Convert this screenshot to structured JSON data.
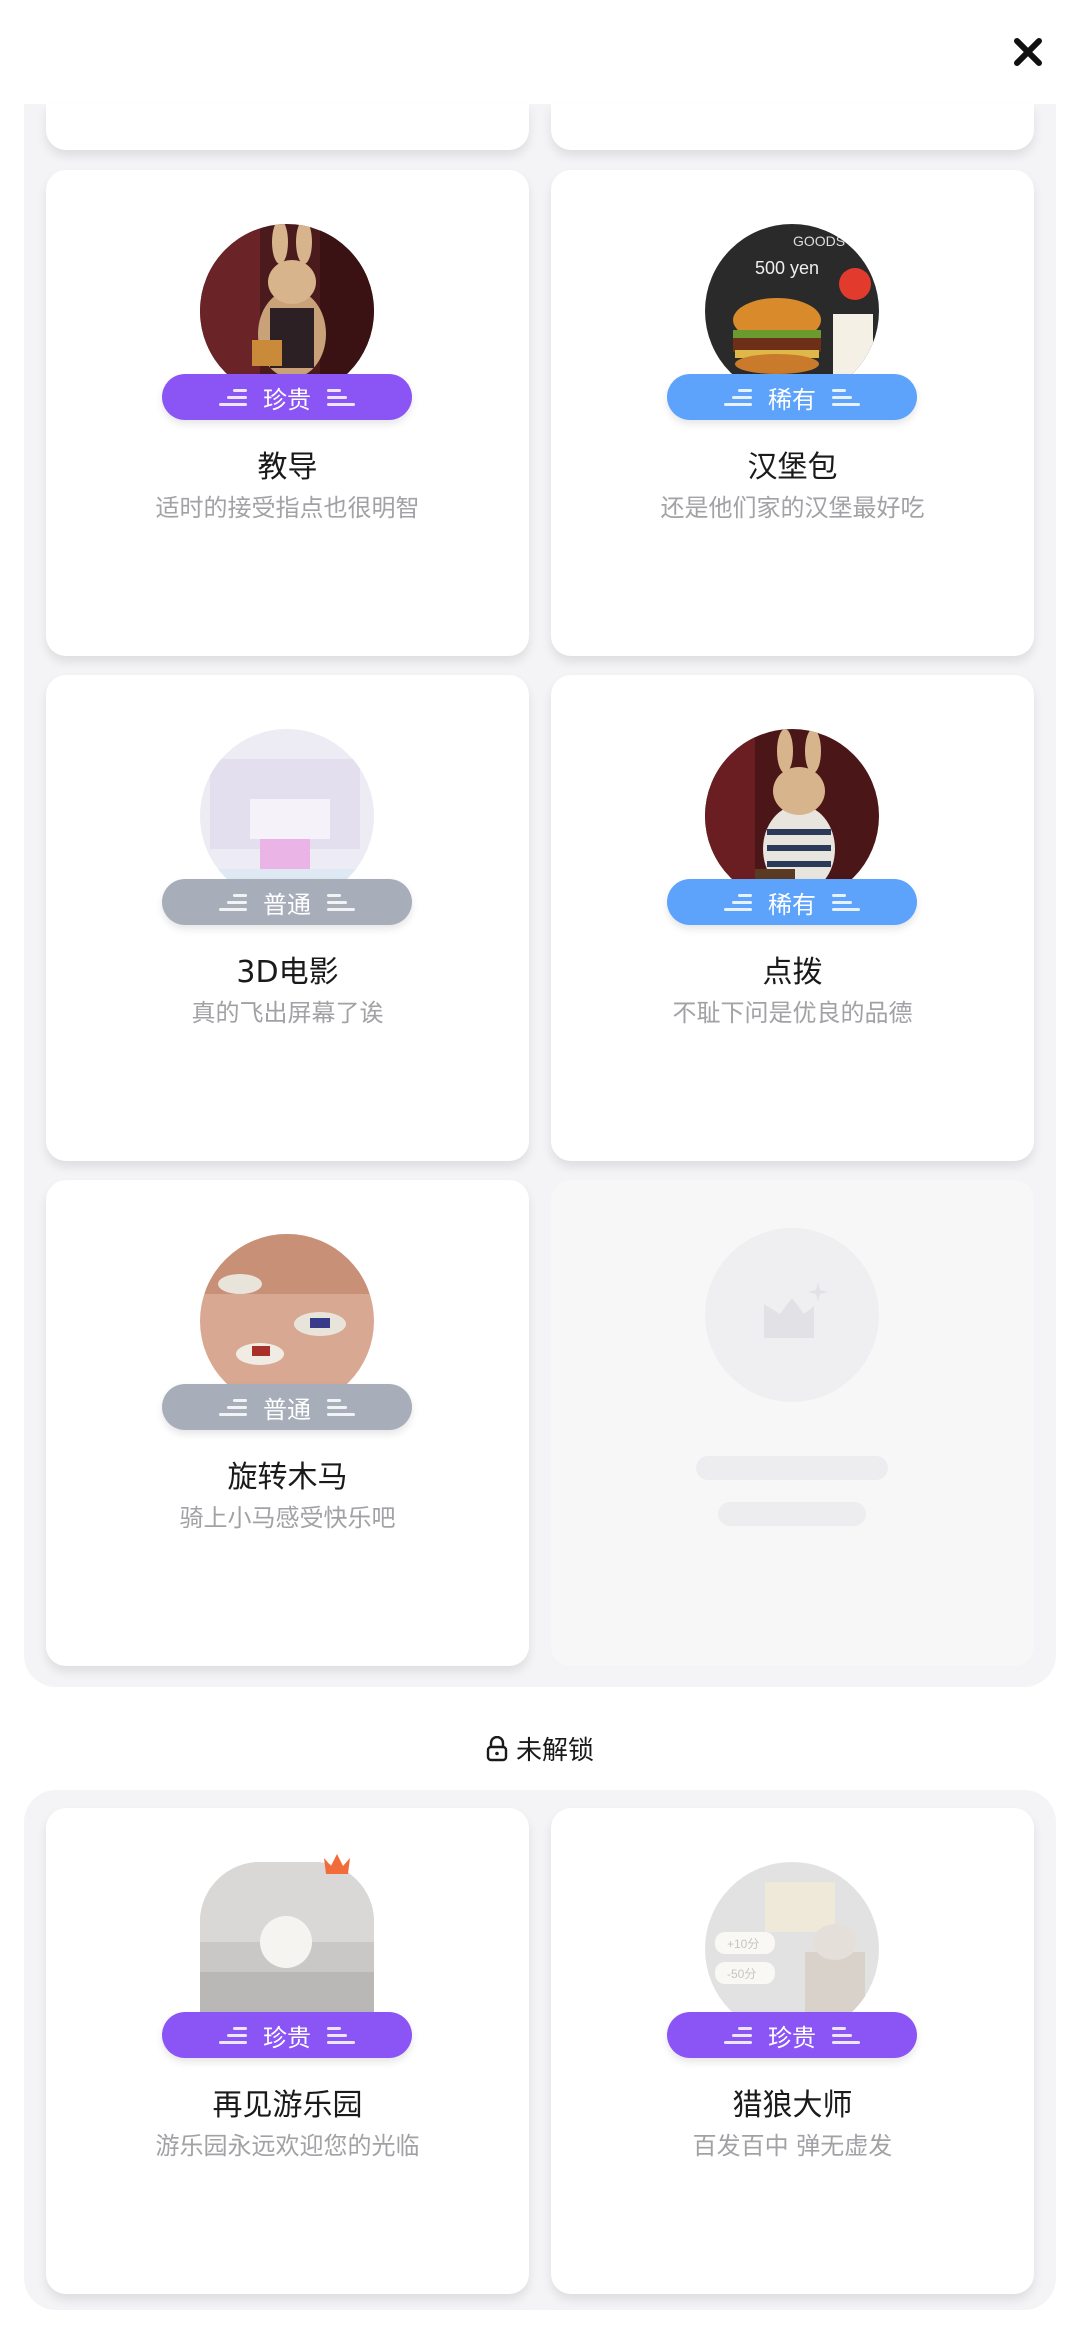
{
  "unlocked": {
    "cards": [
      {
        "title": "教导",
        "desc": "适时的接受指点也很明智",
        "rarity": "珍贵"
      },
      {
        "title": "汉堡包",
        "desc": "还是他们家的汉堡最好吃",
        "rarity": "稀有"
      },
      {
        "title": "3D电影",
        "desc": "真的飞出屏幕了诶",
        "rarity": "普通"
      },
      {
        "title": "点拨",
        "desc": "不耻下问是优良的品德",
        "rarity": "稀有"
      },
      {
        "title": "旋转木马",
        "desc": "骑上小马感受快乐吧",
        "rarity": "普通"
      }
    ]
  },
  "locked_section": {
    "label": "未解锁",
    "cards": [
      {
        "title": "再见游乐园",
        "desc": "游乐园永远欢迎您的光临",
        "rarity": "珍贵"
      },
      {
        "title": "猎狼大师",
        "desc": "百发百中 弹无虚发",
        "rarity": "珍贵"
      }
    ]
  },
  "image_text": {
    "burger_sign_goods": "GOODS",
    "burger_price": "500 yen",
    "wolf_score_plus": "+10分",
    "wolf_score_minus": "-50分"
  },
  "colors": {
    "precious": "#8b55f6",
    "rare": "#5ea3fb",
    "common": "#a7aeba",
    "panel_bg": "#f4f4f6"
  },
  "icons": {
    "close": "close-icon",
    "lock": "lock-icon",
    "placeholder": "image-placeholder-icon"
  }
}
